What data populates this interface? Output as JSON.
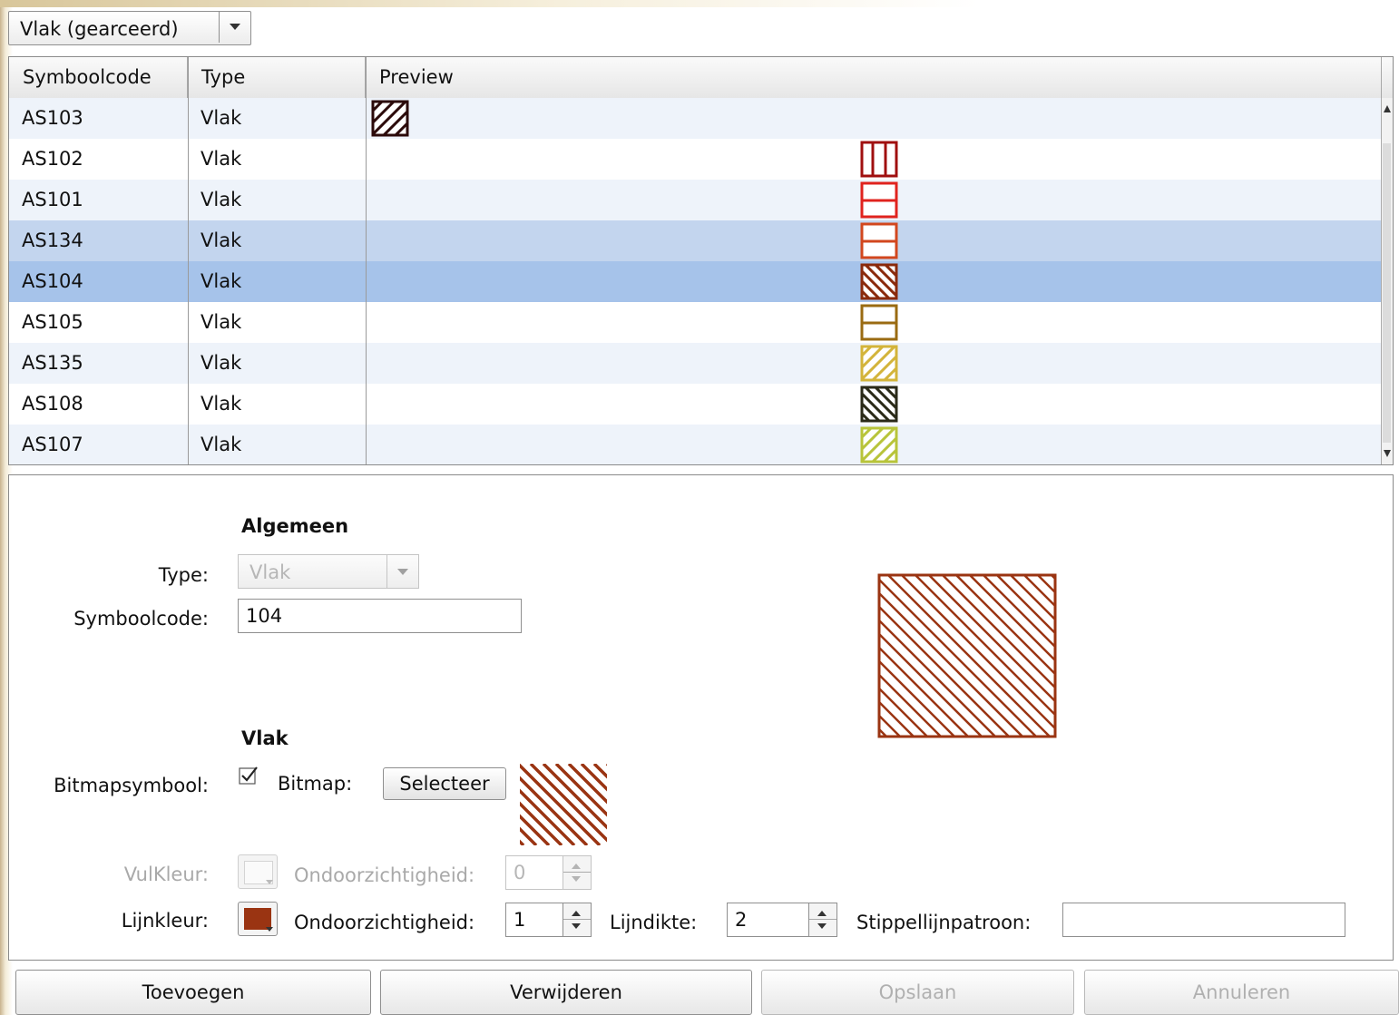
{
  "combo": {
    "value": "Vlak (gearceerd)"
  },
  "table": {
    "columns": [
      "Symboolcode",
      "Type",
      "Preview"
    ],
    "rows": [
      {
        "code": "AS103",
        "type": "Vlak",
        "color": "#2b0a0a",
        "pattern": "diag-up"
      },
      {
        "code": "AS102",
        "type": "Vlak",
        "color": "#a00f0f",
        "pattern": "vertical"
      },
      {
        "code": "AS101",
        "type": "Vlak",
        "color": "#e0231e",
        "pattern": "horizontal"
      },
      {
        "code": "AS134",
        "type": "Vlak",
        "color": "#d2471e",
        "pattern": "horizontal"
      },
      {
        "code": "AS104",
        "type": "Vlak",
        "color": "#8a2a0c",
        "pattern": "diag-down"
      },
      {
        "code": "AS105",
        "type": "Vlak",
        "color": "#9a6b12",
        "pattern": "horizontal"
      },
      {
        "code": "AS135",
        "type": "Vlak",
        "color": "#d3b43a",
        "pattern": "diag-up"
      },
      {
        "code": "AS108",
        "type": "Vlak",
        "color": "#2a2a18",
        "pattern": "diag-down"
      },
      {
        "code": "AS107",
        "type": "Vlak",
        "color": "#b8c43a",
        "pattern": "diag-up"
      }
    ],
    "selected_index": 4,
    "hover_index": 3
  },
  "form": {
    "general_heading": "Algemeen",
    "type_label": "Type:",
    "type_value": "Vlak",
    "code_label": "Symboolcode:",
    "code_value": "104",
    "vlak_heading": "Vlak",
    "bitmap_symbol_label": "Bitmapsymbool:",
    "bitmap_symbol_checked": true,
    "bitmap_label": "Bitmap:",
    "select_button": "Selecteer",
    "fill_color_label": "VulKleur:",
    "fill_opacity_label": "Ondoorzichtigheid:",
    "fill_opacity_value": "0",
    "line_color_label": "Lijnkleur:",
    "line_color": "#9a3412",
    "line_opacity_label": "Ondoorzichtigheid:",
    "line_opacity_value": "1",
    "line_width_label": "Lijndikte:",
    "line_width_value": "2",
    "dash_pattern_label": "Stippellijnpatroon:",
    "dash_pattern_value": "",
    "preview_color": "#9a3412"
  },
  "buttons": {
    "add": "Toevoegen",
    "remove": "Verwijderen",
    "save": "Opslaan",
    "cancel": "Annuleren"
  }
}
